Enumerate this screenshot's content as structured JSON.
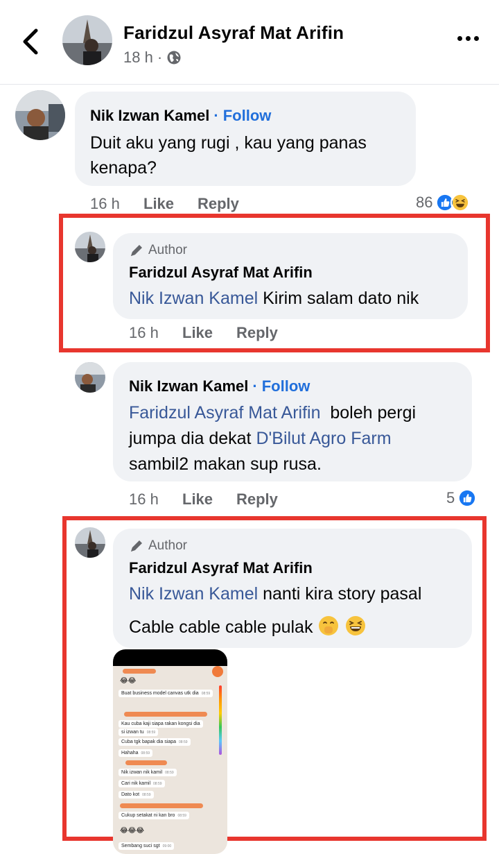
{
  "header": {
    "title": "Faridzul Asyraf Mat Arifin",
    "time": "18 h",
    "separator": "·",
    "icons": {
      "back": "back-chevron-icon",
      "privacy": "globe-icon",
      "more": "more-icon"
    }
  },
  "comments": [
    {
      "name": "Nik Izwan Kamel",
      "follow": "Follow",
      "dot": "·",
      "text_line1": "Duit aku yang rugi , kau yang panas",
      "text_line2": "kenapa?",
      "time": "16 h",
      "like": "Like",
      "reply": "Reply",
      "reaction_count": "86"
    }
  ],
  "replies": [
    {
      "badge": "Author",
      "name": "Faridzul Asyraf Mat Arifin",
      "mention": "Nik Izwan Kamel",
      "text": " Kirim salam dato nik",
      "time": "16 h",
      "like": "Like",
      "reply": "Reply"
    },
    {
      "name": "Nik Izwan Kamel",
      "follow": "Follow",
      "dot": "·",
      "mention1": "Faridzul Asyraf Mat Arifin",
      "text1": "  boleh pergi",
      "text2a": "jumpa dia dekat ",
      "mention2": "D'Bilut Agro Farm",
      "text3": "sambil2 makan sup rusa.",
      "time": "16 h",
      "like": "Like",
      "reply": "Reply",
      "reaction_count": "5"
    },
    {
      "badge": "Author",
      "name": "Faridzul Asyraf Mat Arifin",
      "mention": "Nik Izwan Kamel",
      "text1": " nanti kira story pasal",
      "text2": "Cable cable cable pulak"
    }
  ],
  "attachment_chat": [
    {
      "text": "Buat business model canvas utk dia",
      "time": "08:59"
    },
    {
      "text": "Kau cuba kaji siapa rakan kongsi dia",
      "time": ""
    },
    {
      "text": "si izwan tu",
      "time": "08:59"
    },
    {
      "text": "Cuba tgk bapak dia siapa",
      "time": "08:59"
    },
    {
      "text": "Hahaha",
      "time": "08:59"
    },
    {
      "text": "Nik izwan nik kamil",
      "time": "08:59"
    },
    {
      "text": "Cari nik kamil",
      "time": "08:59"
    },
    {
      "text": "Dato kot",
      "time": "08:59"
    },
    {
      "text": "Cukup setakat ni kan bro",
      "time": "08:59"
    },
    {
      "text": "Sembang suci sgt",
      "time": "09:00"
    }
  ],
  "colors": {
    "accent": "#216fdb",
    "mention": "#385898",
    "highlight": "#e8362e",
    "bubble": "#f0f2f5"
  }
}
